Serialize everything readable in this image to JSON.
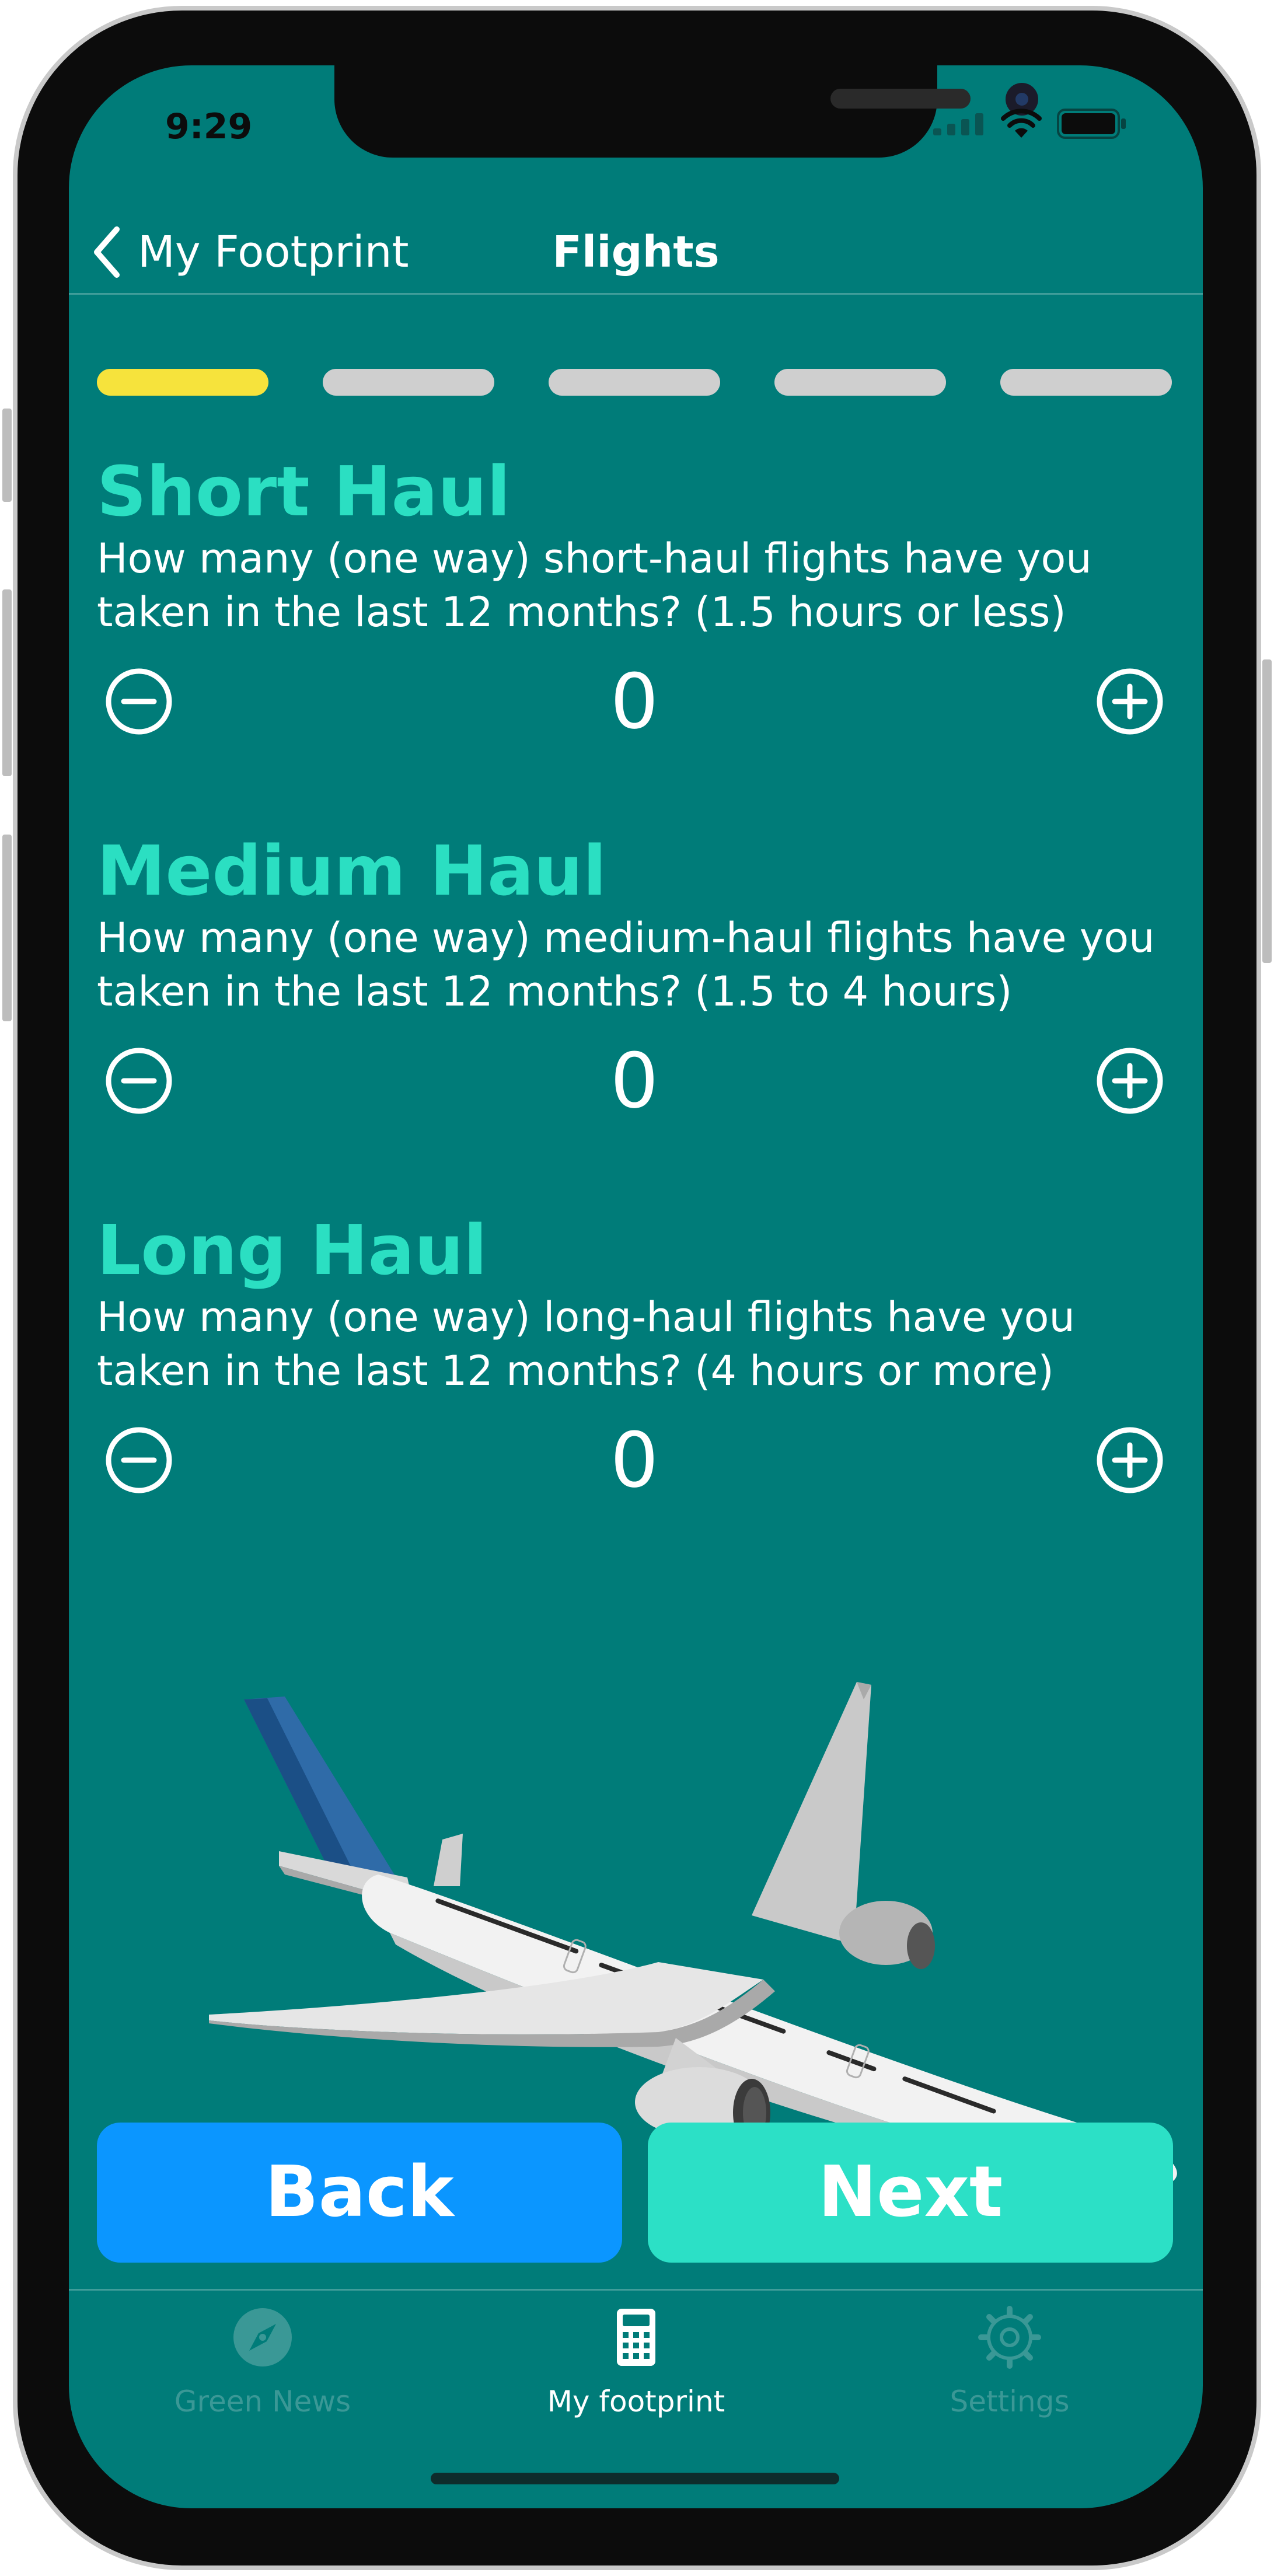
{
  "status_bar": {
    "time": "9:29"
  },
  "nav": {
    "back_label": "My Footprint",
    "title": "Flights"
  },
  "progress": {
    "total_steps": 5,
    "current_step": 1
  },
  "sections": [
    {
      "title": "Short Haul",
      "line1": "How many (one way) short-haul flights have you",
      "line2": "taken in the last 12 months? (1.5 hours or less)",
      "value": "0"
    },
    {
      "title": "Medium Haul",
      "line1": "How many (one way) medium-haul flights have you",
      "line2": "taken in the last 12 months? (1.5 to 4 hours)",
      "value": "0"
    },
    {
      "title": "Long Haul",
      "line1": "How many (one way) long-haul flights have you",
      "line2": "taken in the last 12 months? (4 hours or more)",
      "value": "0"
    }
  ],
  "buttons": {
    "back": "Back",
    "next": "Next"
  },
  "tabs": [
    {
      "label": "Green News",
      "icon": "compass-icon",
      "active": false
    },
    {
      "label": "My footprint",
      "icon": "calculator-icon",
      "active": true
    },
    {
      "label": "Settings",
      "icon": "gear-icon",
      "active": false
    }
  ],
  "colors": {
    "background": "#007c79",
    "accent": "#2bdfc2",
    "progress_active": "#f6e33c",
    "back_button": "#0b96ff",
    "next_button": "#2ce0c6"
  }
}
